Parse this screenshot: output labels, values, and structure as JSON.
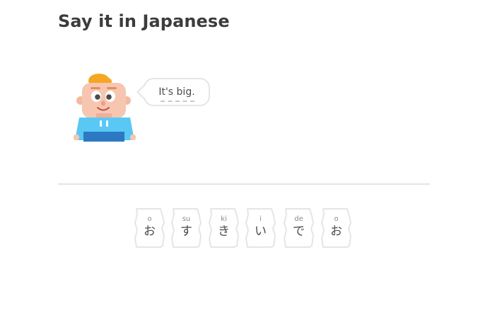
{
  "header": {
    "title": "Say it in Japanese"
  },
  "prompt": {
    "speech_text": "It's big."
  },
  "character": {
    "name_icon": "character-avatar"
  },
  "word_bank": {
    "tiles": [
      {
        "romaji": "o",
        "kana": "お"
      },
      {
        "romaji": "su",
        "kana": "す"
      },
      {
        "romaji": "ki",
        "kana": "き"
      },
      {
        "romaji": "i",
        "kana": "い"
      },
      {
        "romaji": "de",
        "kana": "で"
      },
      {
        "romaji": "o",
        "kana": "お"
      }
    ]
  },
  "colors": {
    "title": "#3c3c3c",
    "border": "#e5e5e5",
    "hair": "#f5a623",
    "skin": "#f7c6b0",
    "shirt": "#5ac8f4",
    "pants": "#2b79c2"
  }
}
